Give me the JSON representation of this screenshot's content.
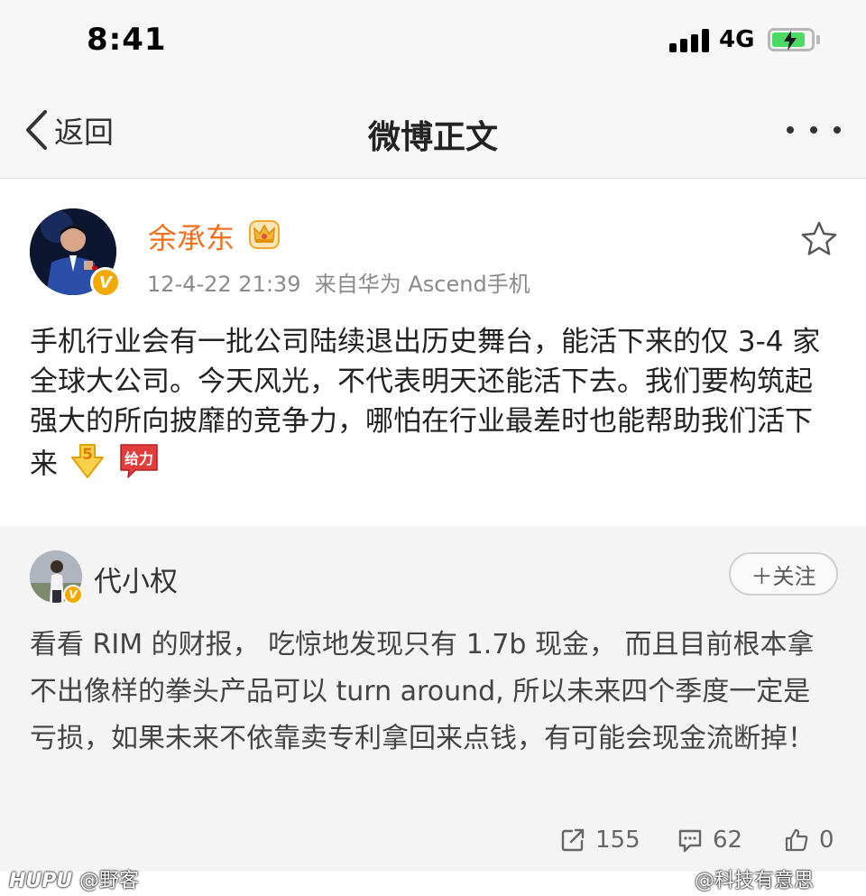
{
  "status_bar": {
    "time": "8:41",
    "network": "4G",
    "battery_level": 0.85,
    "battery_color": "#4cd964"
  },
  "nav": {
    "back_label": "返回",
    "title": "微博正文",
    "more_icon": "more-dots-icon"
  },
  "post": {
    "username": "余承东",
    "username_color": "#f46f1e",
    "timestamp": "12-4-22 21:39",
    "source": "来自华为 Ascend手机",
    "text": "手机行业会有一批公司陆续退出历史舞台，能活下来的仅 3-4 家全球大公司。今天风光，不代表明天还能活下去。我们要构筑起强大的所向披靡的竞争力，哪怕在行业最差时也能帮助我们活下来",
    "emoji_1": "5",
    "emoji_2": "给力",
    "favorite_icon": "star-icon",
    "badge_icon": "crown-icon"
  },
  "repost": {
    "username": "代小权",
    "follow_label": "＋关注",
    "text": "看看 RIM 的财报， 吃惊地发现只有 1.7b 现金， 而且目前根本拿不出像样的拳头产品可以 turn around, 所以未来四个季度一定是亏损，如果未来不依靠卖专利拿回来点钱，有可能会现金流断掉！",
    "actions": {
      "repost_count": "155",
      "comment_count": "62",
      "like_count": "0"
    }
  },
  "watermark": {
    "left_brand": "HUPU",
    "left_handle": "@野客",
    "right": "@科技有意思"
  }
}
